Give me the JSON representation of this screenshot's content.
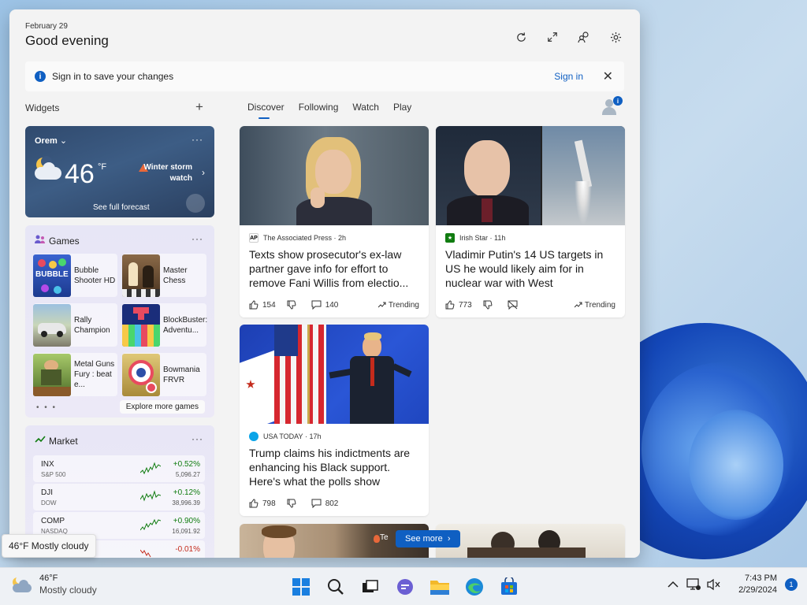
{
  "header": {
    "date": "February 29",
    "greeting": "Good evening"
  },
  "signin_bar": {
    "message": "Sign in to save your changes",
    "link": "Sign in"
  },
  "widgets_title": "Widgets",
  "add_label": "+",
  "tabs": [
    "Discover",
    "Following",
    "Watch",
    "Play"
  ],
  "avatar_badge": "i",
  "weather": {
    "location": "Orem",
    "temp": "46",
    "unit": "°F",
    "alert": "Winter storm watch",
    "forecast_link": "See full forecast"
  },
  "games": {
    "title": "Games",
    "items": [
      {
        "name": "Bubble Shooter HD",
        "color": "#2d4fa8"
      },
      {
        "name": "Master Chess",
        "color": "#6b4a2e"
      },
      {
        "name": "Rally Champion",
        "color": "#7a9a6a"
      },
      {
        "name": "BlockBuster: Adventu...",
        "color": "#1a2d7a"
      },
      {
        "name": "Metal Guns Fury : beat e...",
        "color": "#6f8a3a"
      },
      {
        "name": "Bowmania FRVR",
        "color": "#c7a13a"
      }
    ],
    "dots": "• • •",
    "explore": "Explore more games"
  },
  "market": {
    "title": "Market",
    "stocks": [
      {
        "symbol": "INX",
        "index": "S&P 500",
        "change": "+0.52%",
        "price": "5,096.27"
      },
      {
        "symbol": "DJI",
        "index": "DOW",
        "change": "+0.12%",
        "price": "38,996.39"
      },
      {
        "symbol": "COMP",
        "index": "NASDAQ",
        "change": "+0.90%",
        "price": "16,091.92"
      },
      {
        "symbol": "",
        "index": "",
        "change": "-0.01%",
        "price": ""
      }
    ]
  },
  "feed": [
    {
      "source": "The Associated Press",
      "time": "2h",
      "title": "Texts show prosecutor's ex-law partner gave info for effort to remove Fani Willis from electio...",
      "likes": "154",
      "comments": "140",
      "trend": "Trending"
    },
    {
      "source": "Irish Star",
      "time": "11h",
      "title": "Vladimir Putin's 14 US targets in US he would likely aim for in nuclear war with West",
      "likes": "773",
      "trend": "Trending"
    },
    {
      "source": "USA TODAY",
      "time": "17h",
      "title": "Trump claims his indictments are enhancing his Black support. Here's what the polls show",
      "likes": "798",
      "comments": "802"
    }
  ],
  "see_more": "See more",
  "peek_label": "Te",
  "tooltip": "46°F Mostly cloudy",
  "taskbar": {
    "temp": "46°F",
    "condition": "Mostly cloudy",
    "time": "7:43 PM",
    "date": "2/29/2024",
    "notifications": "1"
  },
  "colors": {
    "accent": "#0f5fc2",
    "positive": "#107c10",
    "negative": "#c42b1c"
  }
}
